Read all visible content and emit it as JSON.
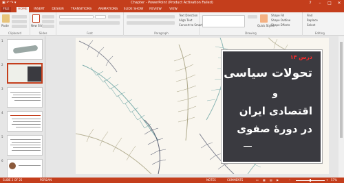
{
  "titlebar": {
    "title": "Chapter - PowerPoint (Product Activation Failed)"
  },
  "tabs": [
    "FILE",
    "HOME",
    "INSERT",
    "DESIGN",
    "TRANSITIONS",
    "ANIMATIONS",
    "SLIDE SHOW",
    "REVIEW",
    "VIEW"
  ],
  "ribbon": {
    "groups": [
      "Clipboard",
      "Slides",
      "Font",
      "Paragraph",
      "Drawing",
      "Editing"
    ],
    "paste": "Paste",
    "new_slide": "New Slide",
    "text_direction": "Text Direction",
    "align_text": "Align Text",
    "convert_smartart": "Convert to SmartArt",
    "quick_styles": "Quick Styles",
    "shape_fill": "Shape Fill",
    "shape_outline": "Shape Outline",
    "shape_effects": "Shape Effects",
    "find": "Find",
    "replace": "Replace",
    "select": "Select"
  },
  "slide": {
    "lesson": "درس ۱۳",
    "line1": "تحولات سیاسی",
    "line2": "و",
    "line3": "اقتصادی ایران",
    "line4": "در دورۀ صفوی"
  },
  "thumbs": [
    "1",
    "2",
    "3",
    "4",
    "5",
    "6"
  ],
  "status": {
    "slide": "SLIDE 2 OF 25",
    "lang": "PERSIAN",
    "notes": "NOTES",
    "comments": "COMMENTS",
    "zoom": "57%"
  },
  "colors": {
    "accent": "#c43e1c",
    "card": "#3a3a40",
    "lesson_red": "#ff2a2a",
    "feather_teal": "#5a9a9a",
    "feather_olive": "#9a9470",
    "feather_navy": "#2d3550"
  }
}
